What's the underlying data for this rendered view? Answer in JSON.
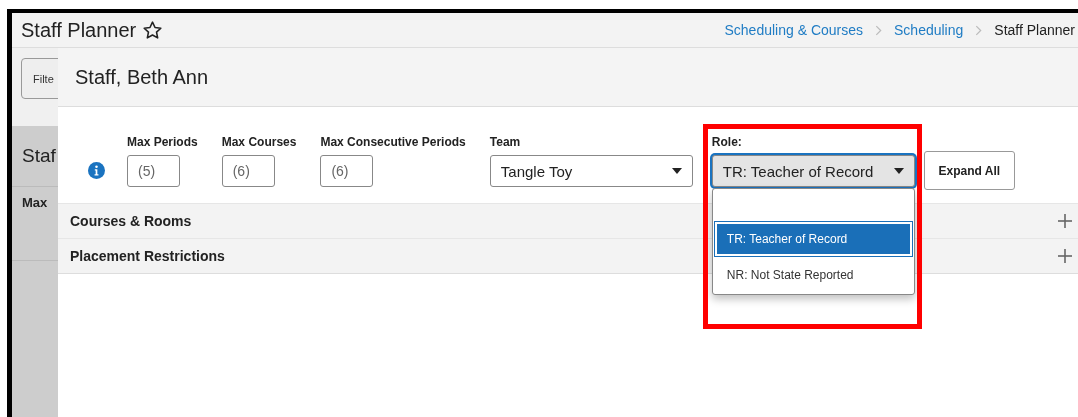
{
  "page": {
    "title": "Staff Planner",
    "favorite": false
  },
  "breadcrumbs": [
    {
      "label": "Scheduling & Courses",
      "kind": "link"
    },
    {
      "label": "Scheduling",
      "kind": "link"
    },
    {
      "label": "Staff Planner",
      "kind": "current"
    }
  ],
  "background": {
    "filter_button": "Filte",
    "heading": "Staf",
    "column_label": "Max"
  },
  "panel": {
    "title": "Staff, Beth Ann",
    "fields": [
      {
        "label": "Max Periods",
        "kind": "number",
        "placeholder": "(5)"
      },
      {
        "label": "Max Courses",
        "kind": "number",
        "placeholder": "(6)"
      },
      {
        "label": "Max Consecutive Periods",
        "kind": "number",
        "placeholder": "(6)"
      },
      {
        "label": "Team",
        "kind": "select",
        "value": "Tangle Toy",
        "focused": false
      },
      {
        "label": "Role:",
        "kind": "select",
        "value": "TR: Teacher of Record",
        "focused": true
      }
    ],
    "expand_button": "Expand All",
    "sections": [
      {
        "label": "Courses & Rooms",
        "expanded": false
      },
      {
        "label": "Placement Restrictions",
        "expanded": false
      }
    ],
    "role_dropdown": {
      "options": [
        {
          "label": "TR: Teacher of Record",
          "selected": true
        },
        {
          "label": "NR: Not State Reported",
          "selected": false
        }
      ]
    }
  },
  "highlight": {
    "shown": true
  }
}
